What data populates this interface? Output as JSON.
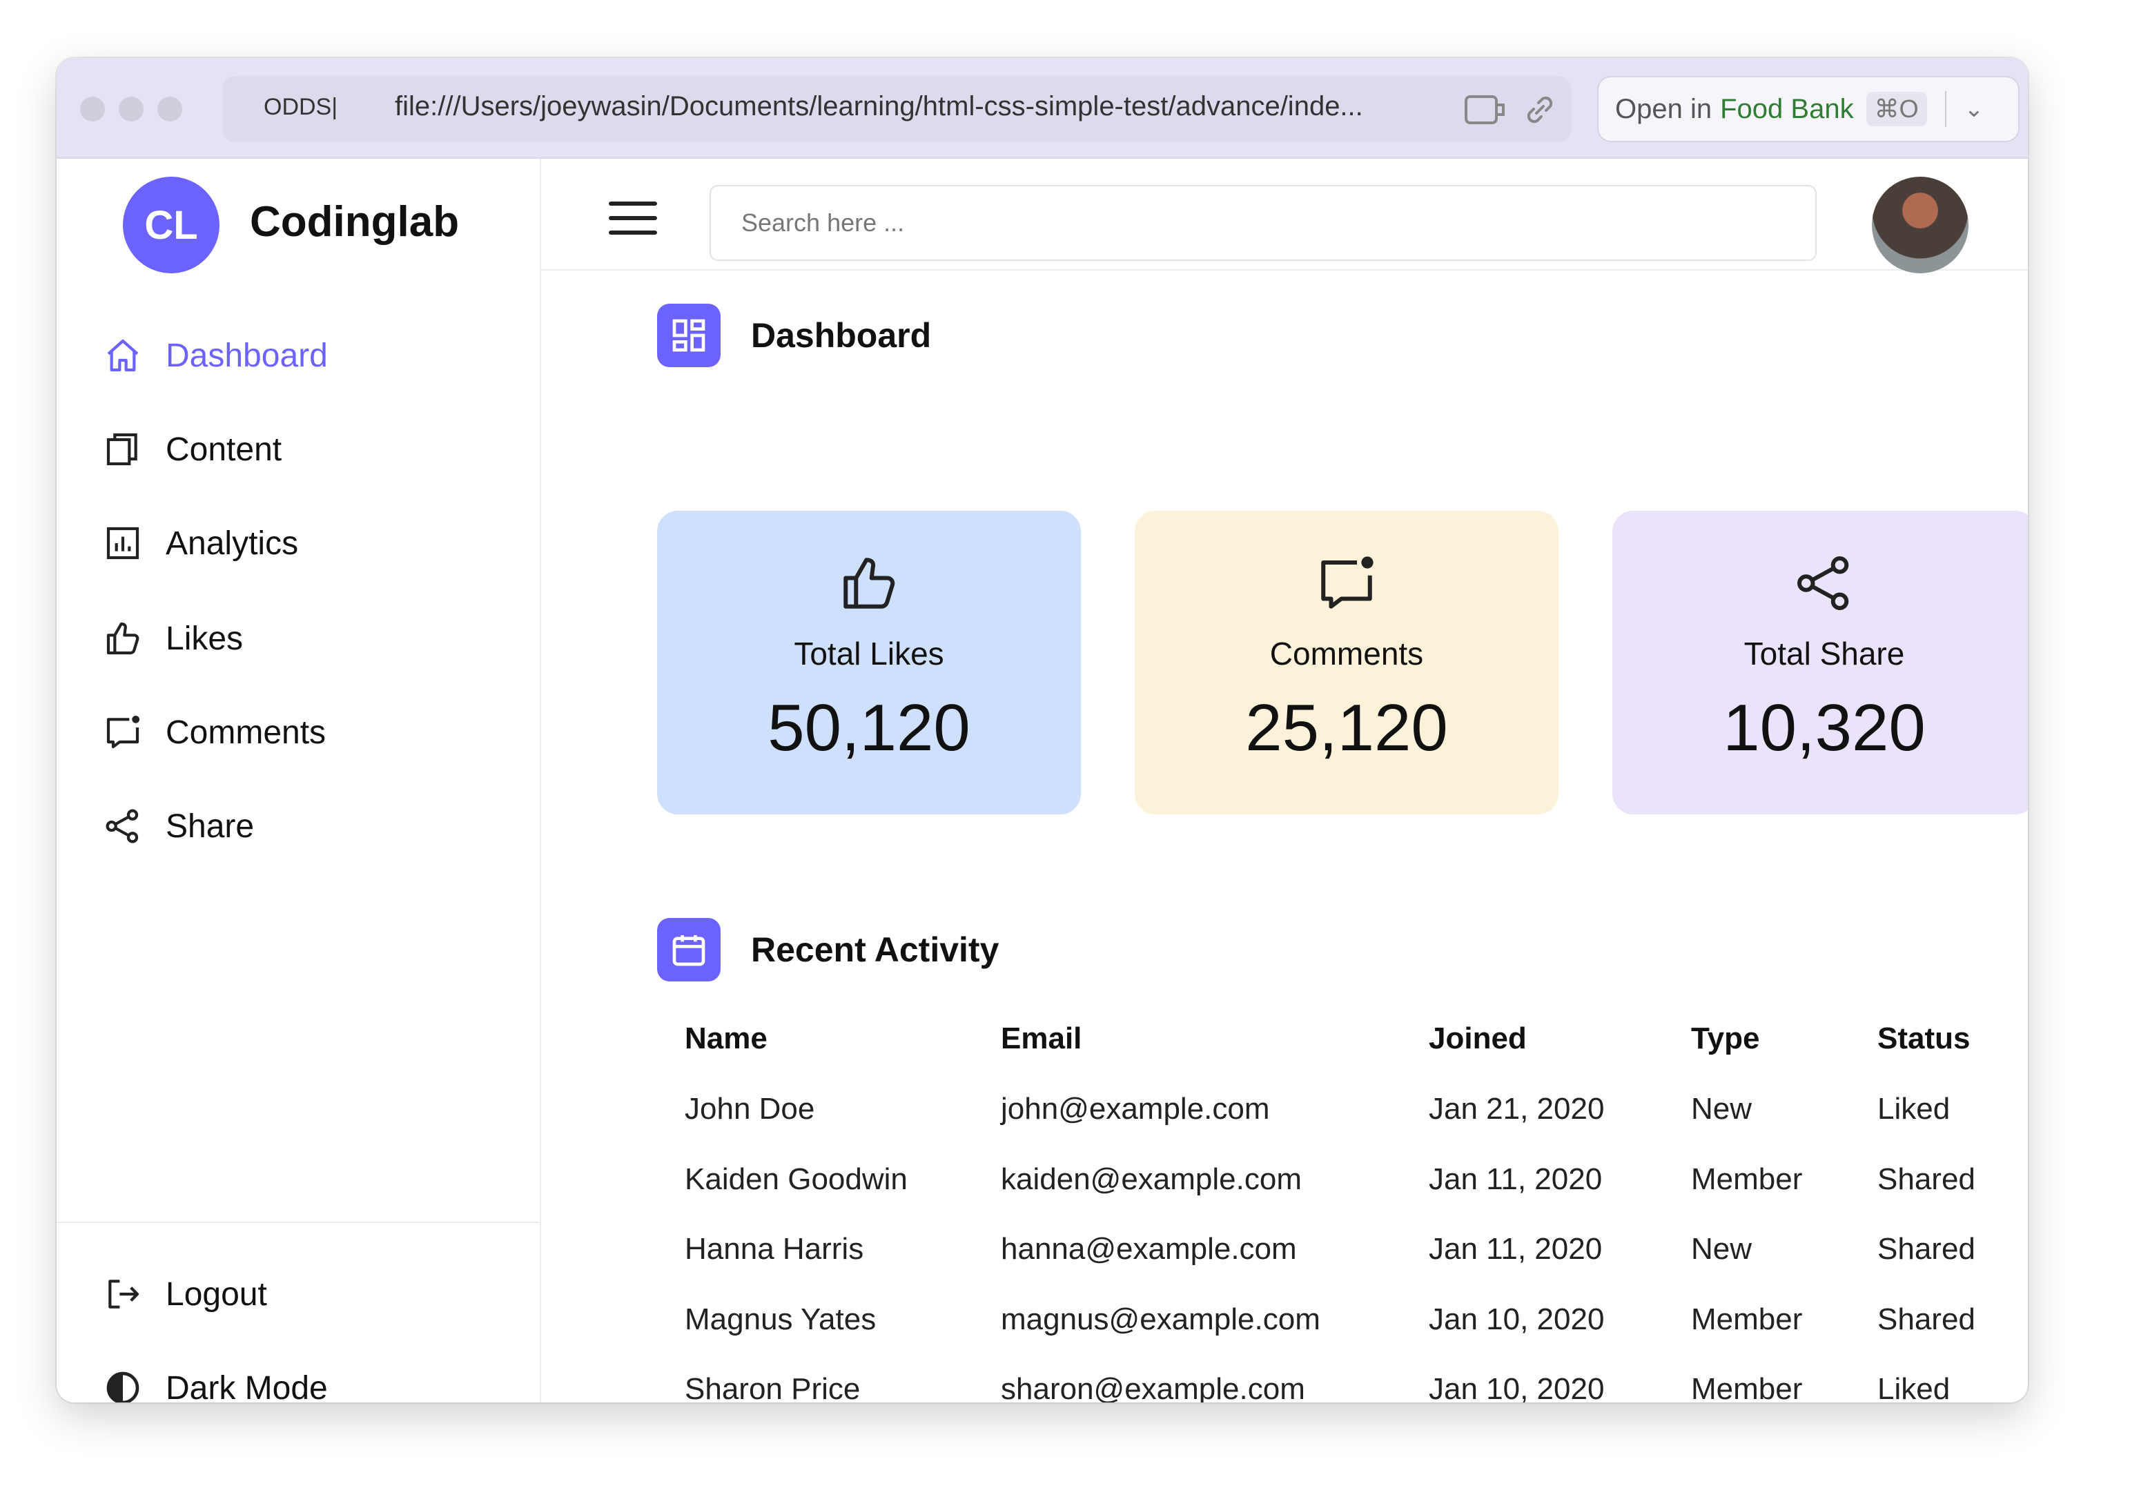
{
  "browser": {
    "tab_name": "ODDS|",
    "url": "file:///Users/joeywasin/Documents/learning/html-css-simple-test/advance/inde...",
    "open_in_prefix": "Open in",
    "open_in_app": "Food Bank",
    "open_in_shortcut": "⌘O"
  },
  "sidebar": {
    "logo_initials": "CL",
    "brand": "Codinglab",
    "items": [
      {
        "label": "Dashboard",
        "icon": "home-icon",
        "active": true
      },
      {
        "label": "Content",
        "icon": "copy-icon",
        "active": false
      },
      {
        "label": "Analytics",
        "icon": "chart-icon",
        "active": false
      },
      {
        "label": "Likes",
        "icon": "thumbs-up-icon",
        "active": false
      },
      {
        "label": "Comments",
        "icon": "comment-icon",
        "active": false
      },
      {
        "label": "Share",
        "icon": "share-icon",
        "active": false
      }
    ],
    "bottom": [
      {
        "label": "Logout",
        "icon": "logout-icon"
      },
      {
        "label": "Dark Mode",
        "icon": "contrast-icon"
      }
    ]
  },
  "topbar": {
    "search_placeholder": "Search here ..."
  },
  "dashboard": {
    "title": "Dashboard",
    "cards": [
      {
        "title": "Total Likes",
        "value": "50,120",
        "icon": "thumbs-up-icon",
        "color": "#cfe0fc"
      },
      {
        "title": "Comments",
        "value": "25,120",
        "icon": "comment-icon",
        "color": "#fbf2d9"
      },
      {
        "title": "Total Share",
        "value": "10,320",
        "icon": "share-icon",
        "color": "#ebe3fb"
      }
    ]
  },
  "activity": {
    "title": "Recent Activity",
    "columns": [
      "Name",
      "Email",
      "Joined",
      "Type",
      "Status"
    ],
    "rows": [
      [
        "John Doe",
        "john@example.com",
        "Jan 21, 2020",
        "New",
        "Liked"
      ],
      [
        "Kaiden Goodwin",
        "kaiden@example.com",
        "Jan 11, 2020",
        "Member",
        "Shared"
      ],
      [
        "Hanna Harris",
        "hanna@example.com",
        "Jan 11, 2020",
        "New",
        "Shared"
      ],
      [
        "Magnus Yates",
        "magnus@example.com",
        "Jan 10, 2020",
        "Member",
        "Shared"
      ],
      [
        "Sharon Price",
        "sharon@example.com",
        "Jan 10, 2020",
        "Member",
        "Liked"
      ]
    ]
  },
  "colors": {
    "accent": "#6c63ff"
  }
}
